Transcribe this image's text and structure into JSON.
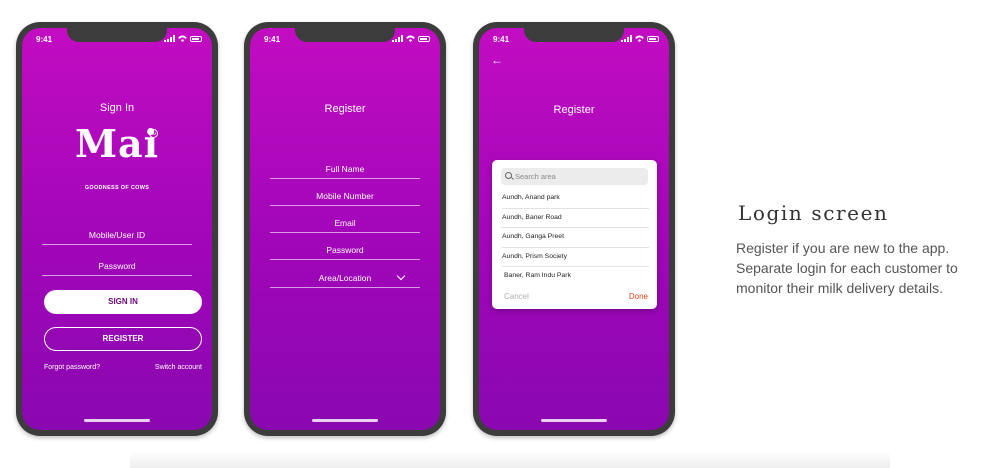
{
  "status_time": "9:41",
  "signin_screen": {
    "title": "Sign In",
    "logo_text": "Mai",
    "trademark": "TM",
    "tagline": "GOODNESS OF COWS",
    "mobile_field": "Mobile/User ID",
    "password_field": "Password",
    "signin_button": "SIGN IN",
    "register_button": "REGISTER",
    "forgot_link": "Forgot password?",
    "switch_link": "Switch account"
  },
  "register_screen": {
    "title": "Register",
    "fields": [
      "Full Name",
      "Mobile Number",
      "Email",
      "Password",
      "Area/Location"
    ]
  },
  "area_screen": {
    "title": "Register",
    "search_placeholder": "Search area",
    "areas": [
      "Aundh, Anand park",
      "Aundh, Baner Road",
      "Aundh, Ganga Preet",
      "Aundh, Prism Society",
      "Baner, Ram Indu Park"
    ],
    "cancel_label": "Cancel",
    "done_label": "Done"
  },
  "description": {
    "heading": "Login screen",
    "body": "Register if you are new to the app. Separate login for each customer to monitor their milk delivery details."
  },
  "colors": {
    "gradient_top": "#c20cc2",
    "gradient_bottom": "#8a08b0",
    "done_accent": "#e0431d"
  },
  "icons": [
    "signal-icon",
    "wifi-icon",
    "battery-icon",
    "chevron-down-icon",
    "back-arrow-icon",
    "search-icon"
  ]
}
